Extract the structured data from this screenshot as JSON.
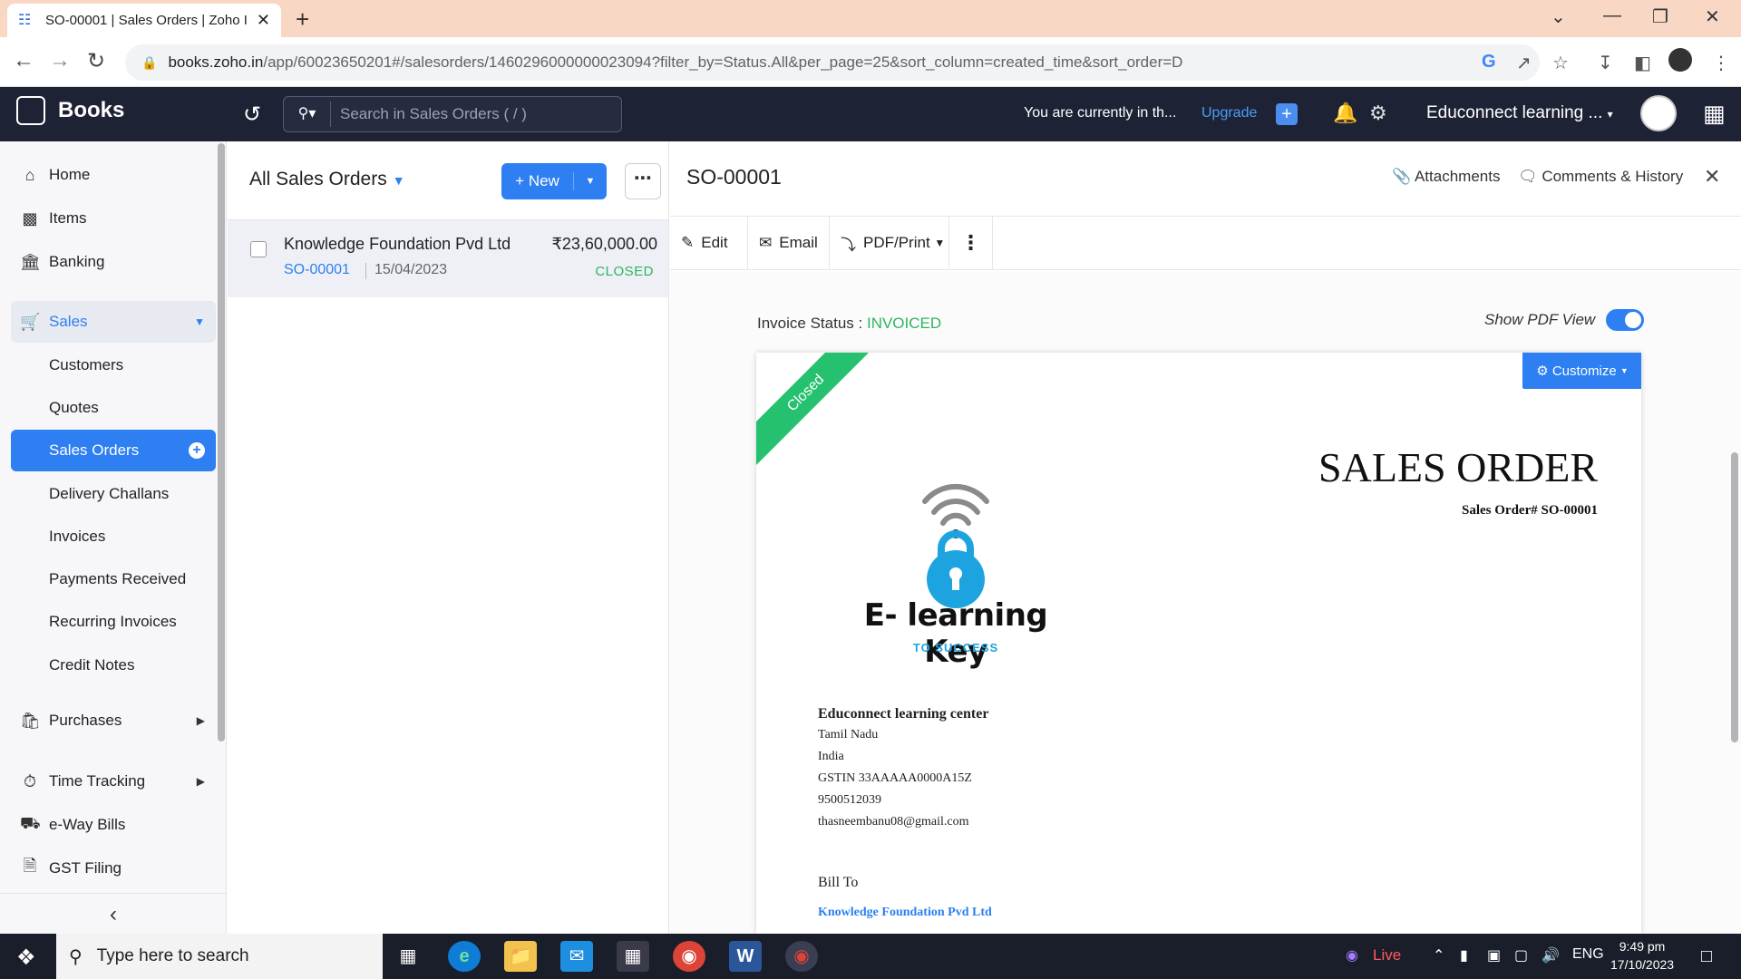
{
  "browser": {
    "tab_title": "SO-00001 | Sales Orders | Zoho I",
    "url_domain": "books.zoho.in",
    "url_path": "/app/60023650201#/salesorders/1460296000000023094?filter_by=Status.All&per_page=25&sort_column=created_time&sort_order=D"
  },
  "header": {
    "app_name": "Books",
    "search_placeholder": "Search in Sales Orders ( / )",
    "trial_text": "You are currently in th...",
    "upgrade_label": "Upgrade",
    "org_name": "Educonnect learning ..."
  },
  "sidebar": {
    "items": [
      {
        "label": "Home",
        "icon": "home-icon"
      },
      {
        "label": "Items",
        "icon": "items-icon"
      },
      {
        "label": "Banking",
        "icon": "bank-icon"
      },
      {
        "label": "Sales",
        "icon": "cart-icon"
      }
    ],
    "sales_sub": [
      "Customers",
      "Quotes",
      "Sales Orders",
      "Delivery Challans",
      "Invoices",
      "Payments Received",
      "Recurring Invoices",
      "Credit Notes"
    ],
    "bottom_items": [
      {
        "label": "Purchases",
        "icon": "bag-icon"
      },
      {
        "label": "Time Tracking",
        "icon": "timer-icon"
      },
      {
        "label": "e-Way Bills",
        "icon": "truck-icon"
      },
      {
        "label": "GST Filing",
        "icon": "document-icon"
      }
    ]
  },
  "list": {
    "title": "All Sales Orders",
    "new_label": "New",
    "rows": [
      {
        "customer": "Knowledge Foundation Pvd Ltd",
        "amount": "₹23,60,000.00",
        "number": "SO-00001",
        "date": "15/04/2023",
        "status": "CLOSED"
      }
    ]
  },
  "detail": {
    "title": "SO-00001",
    "attachments_label": "Attachments",
    "comments_label": "Comments & History",
    "toolbar": {
      "edit": "Edit",
      "email": "Email",
      "pdf_print": "PDF/Print"
    },
    "invoice_status_label": "Invoice Status :",
    "invoice_status_value": "INVOICED",
    "show_pdf_label": "Show PDF View",
    "pdf": {
      "ribbon": "Closed",
      "customize_label": "Customize",
      "heading": "SALES ORDER",
      "order_number": "Sales Order# SO-00001",
      "brand_name": "E- learning Key",
      "brand_tagline": "TO SUCCESS",
      "org_name": "Educonnect learning center",
      "org_lines": [
        "Tamil Nadu",
        "India",
        "GSTIN 33AAAAA0000A15Z",
        "9500512039",
        "thasneembanu08@gmail.com"
      ],
      "bill_to_label": "Bill To",
      "bill_to_customer": "Knowledge Foundation Pvd Ltd"
    }
  },
  "taskbar": {
    "search_placeholder": "Type here to search",
    "live_label": "Live",
    "language": "ENG",
    "time": "9:49 pm",
    "date": "17/10/2023"
  },
  "colors": {
    "accent": "#2d7ff2",
    "header_bg": "#1e2235",
    "status_green": "#2fb55e",
    "ribbon_green": "#25c16f"
  }
}
